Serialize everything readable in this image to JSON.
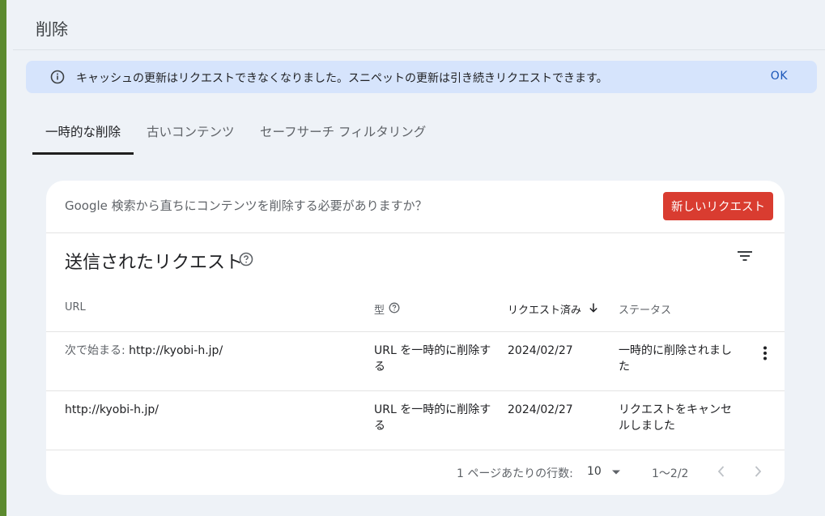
{
  "header": {
    "title": "削除"
  },
  "banner": {
    "icon": "info-icon",
    "message": "キャッシュの更新はリクエストできなくなりました。スニペットの更新は引き続きリクエストできます。",
    "ok_label": "OK"
  },
  "tabs": [
    {
      "label": "一時的な削除",
      "active": true
    },
    {
      "label": "古いコンテンツ",
      "active": false
    },
    {
      "label": "セーフサーチ フィルタリング",
      "active": false
    }
  ],
  "card": {
    "prompt": "Google 検索から直ちにコンテンツを削除する必要がありますか？",
    "new_request_label": "新しいリクエスト",
    "section_title": "送信されたリクエスト"
  },
  "table": {
    "columns": [
      "URL",
      "型",
      "リクエスト済み",
      "ステータス"
    ],
    "rows": [
      {
        "url_prefix": "次で始まる: ",
        "url": "http://kyobi-h.jp/",
        "type": "URL を一時的に削除する",
        "requested": "2024/02/27",
        "status": "一時的に削除されました"
      },
      {
        "url_prefix": "",
        "url": "http://kyobi-h.jp/",
        "type": "URL を一時的に削除する",
        "requested": "2024/02/27",
        "status": "リクエストをキャンセルしました"
      }
    ]
  },
  "pagination": {
    "rows_per_page_label": "1 ページあたりの行数:",
    "rows_per_page": "10",
    "range": "1〜2/2"
  },
  "colors": {
    "accent_button": "#d93c30",
    "banner_bg": "#d6e4fc",
    "left_border": "#5b8a2e",
    "link_blue": "#1a56b8"
  }
}
